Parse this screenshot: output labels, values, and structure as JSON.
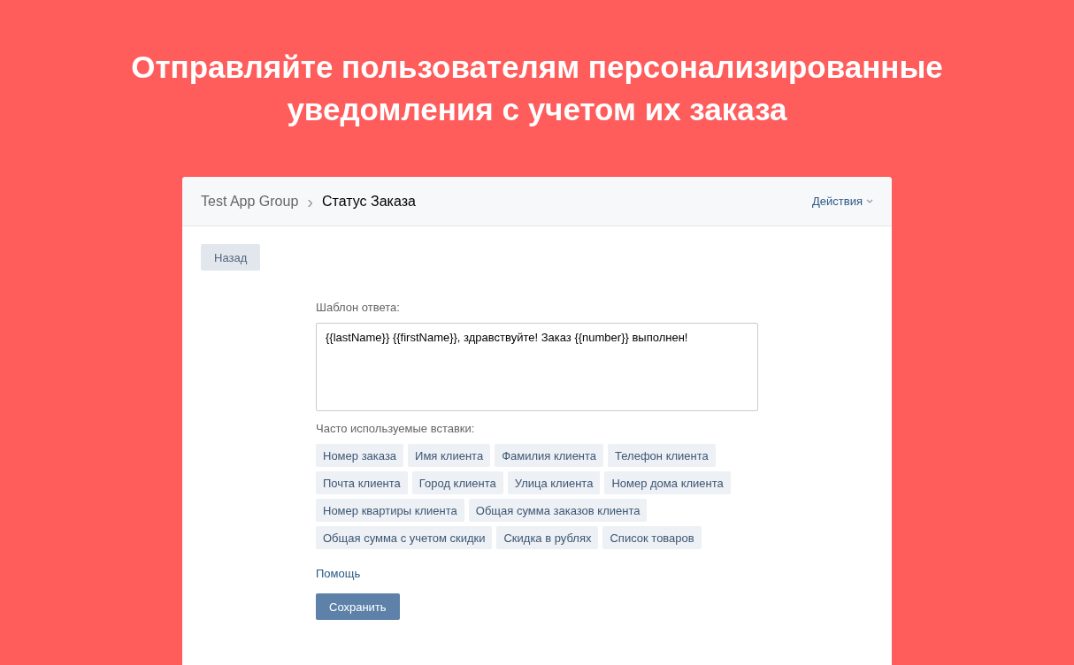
{
  "headline": "Отправляйте пользователям персонализированные уведомления с учетом их заказа",
  "header": {
    "breadcrumb_parent": "Test App Group",
    "separator": "›",
    "title": "Статус Заказа",
    "actions": "Действия"
  },
  "back_button": "Назад",
  "template": {
    "label": "Шаблон ответа:",
    "value": "{{lastName}} {{firstName}}, здравствуйте! Заказ {{number}} выполнен!"
  },
  "inserts": {
    "label": "Часто используемые вставки:",
    "tags": [
      "Номер заказа",
      "Имя клиента",
      "Фамилия клиента",
      "Телефон клиента",
      "Почта клиента",
      "Город клиента",
      "Улица клиента",
      "Номер дома клиента",
      "Номер квартиры клиента",
      "Общая сумма заказов клиента",
      "Общая сумма с учетом скидки",
      "Скидка в рублях",
      "Список товаров"
    ]
  },
  "help_link": "Помощь",
  "save_button": "Сохранить"
}
